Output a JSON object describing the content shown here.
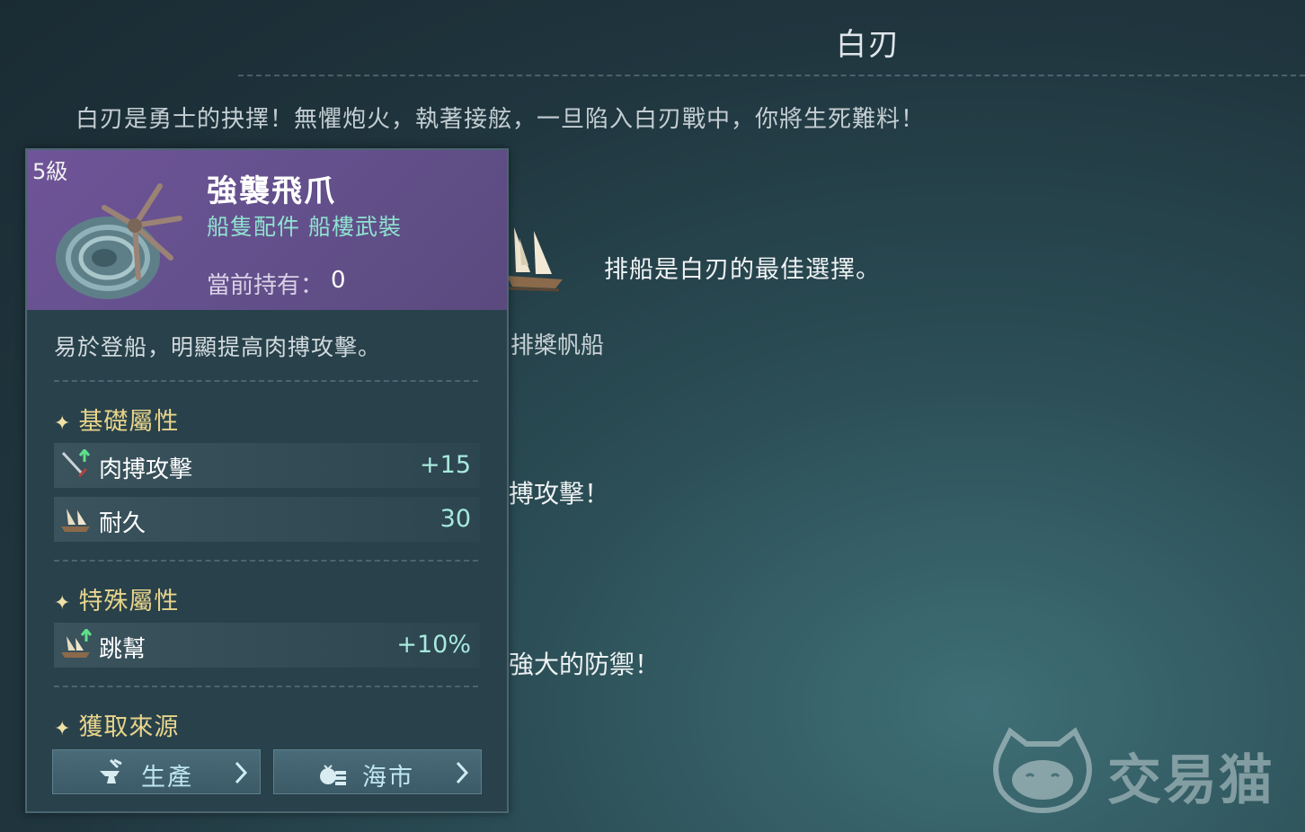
{
  "page": {
    "title": "白刃",
    "intro": "白刃是勇士的抉擇！無懼炮火，執著接舷，一旦陷入白刃戰中，你將生死難料！",
    "ship_recommend": "排船是白刃的最佳選擇。",
    "ship_name": "排槳帆船",
    "fragment_attack": "搏攻擊！",
    "fragment_defense": "強大的防禦！"
  },
  "item": {
    "level": "5級",
    "name": "強襲飛爪",
    "type": "船隻配件 船樓武裝",
    "owned_label": "當前持有：",
    "owned_value": "0",
    "description": "易於登船，明顯提高肉搏攻擊。",
    "base_section": "基礎屬性",
    "base_attrs": [
      {
        "icon": "sword-up-icon",
        "label": "肉搏攻擊",
        "value": "+15"
      },
      {
        "icon": "ship-durability-icon",
        "label": "耐久",
        "value": "30"
      }
    ],
    "special_section": "特殊屬性",
    "special_attrs": [
      {
        "icon": "boarding-up-icon",
        "label": "跳幫",
        "value": "+10%"
      }
    ],
    "source_section": "獲取來源",
    "sources": [
      {
        "icon": "anvil-icon",
        "label": "生產"
      },
      {
        "icon": "market-icon",
        "label": "海市"
      }
    ]
  },
  "watermark": {
    "text": "交易猫"
  },
  "colors": {
    "header_purple": "#6f5498",
    "type_green": "#8fe1cf",
    "section_gold": "#e8d48b",
    "value_teal": "#a7e9dd"
  }
}
